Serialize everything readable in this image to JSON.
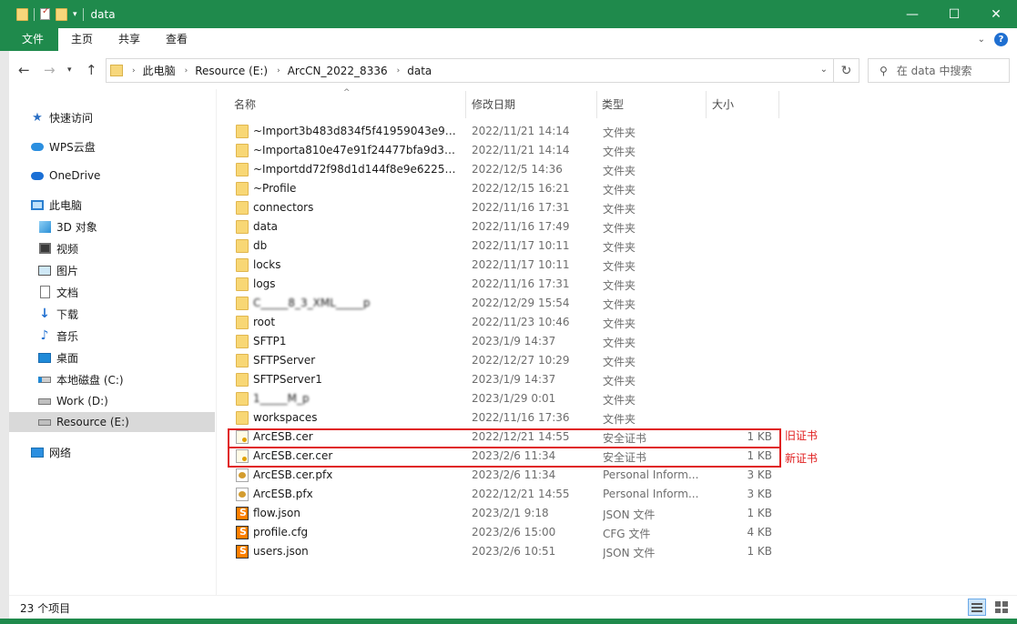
{
  "window": {
    "title": "data",
    "controls": [
      "—",
      "☐",
      "✕"
    ]
  },
  "ribbon": {
    "tabs": [
      "文件",
      "主页",
      "共享",
      "查看"
    ],
    "help": "?"
  },
  "address": {
    "crumbs": [
      "此电脑",
      "Resource (E:)",
      "ArcCN_2022_8336",
      "data"
    ],
    "search_placeholder": "在 data 中搜索"
  },
  "nav": {
    "items": [
      {
        "label": "快速访问",
        "icon": "star-icon"
      },
      {
        "label": "WPS云盘",
        "icon": "cloud-icon"
      },
      {
        "label": "OneDrive",
        "icon": "onedrive-icon"
      },
      {
        "label": "此电脑",
        "icon": "computer-icon"
      },
      {
        "label": "3D 对象",
        "icon": "3d-objects-icon"
      },
      {
        "label": "视频",
        "icon": "video-icon"
      },
      {
        "label": "图片",
        "icon": "pictures-icon"
      },
      {
        "label": "文档",
        "icon": "documents-icon"
      },
      {
        "label": "下载",
        "icon": "download-icon"
      },
      {
        "label": "音乐",
        "icon": "music-icon"
      },
      {
        "label": "桌面",
        "icon": "desktop-icon"
      },
      {
        "label": "本地磁盘 (C:)",
        "icon": "drive-c-icon"
      },
      {
        "label": "Work (D:)",
        "icon": "drive-icon"
      },
      {
        "label": "Resource (E:)",
        "icon": "drive-icon"
      },
      {
        "label": "网络",
        "icon": "network-icon"
      }
    ]
  },
  "columns": {
    "name": "名称",
    "date": "修改日期",
    "type": "类型",
    "size": "大小"
  },
  "files": [
    {
      "name": "~Import3b483d834f5f41959043e9c8...",
      "date": "2022/11/21 14:14",
      "type": "文件夹",
      "size": "",
      "icon": "folder-icon"
    },
    {
      "name": "~Importa810e47e91f24477bfa9d30b...",
      "date": "2022/11/21 14:14",
      "type": "文件夹",
      "size": "",
      "icon": "folder-icon"
    },
    {
      "name": "~Importdd72f98d1d144f8e9e622569...",
      "date": "2022/12/5 14:36",
      "type": "文件夹",
      "size": "",
      "icon": "folder-icon"
    },
    {
      "name": "~Profile",
      "date": "2022/12/15 16:21",
      "type": "文件夹",
      "size": "",
      "icon": "folder-icon"
    },
    {
      "name": "connectors",
      "date": "2022/11/16 17:31",
      "type": "文件夹",
      "size": "",
      "icon": "folder-icon"
    },
    {
      "name": "data",
      "date": "2022/11/16 17:49",
      "type": "文件夹",
      "size": "",
      "icon": "folder-icon"
    },
    {
      "name": "db",
      "date": "2022/11/17 10:11",
      "type": "文件夹",
      "size": "",
      "icon": "folder-icon"
    },
    {
      "name": "locks",
      "date": "2022/11/17 10:11",
      "type": "文件夹",
      "size": "",
      "icon": "folder-icon"
    },
    {
      "name": "logs",
      "date": "2022/11/16 17:31",
      "type": "文件夹",
      "size": "",
      "icon": "folder-icon"
    },
    {
      "name": "C_____8_3_XML_____p",
      "date": "2022/12/29 15:54",
      "type": "文件夹",
      "size": "",
      "icon": "folder-icon",
      "blurred": true
    },
    {
      "name": "root",
      "date": "2022/11/23 10:46",
      "type": "文件夹",
      "size": "",
      "icon": "folder-icon"
    },
    {
      "name": "SFTP1",
      "date": "2023/1/9 14:37",
      "type": "文件夹",
      "size": "",
      "icon": "folder-icon"
    },
    {
      "name": "SFTPServer",
      "date": "2022/12/27 10:29",
      "type": "文件夹",
      "size": "",
      "icon": "folder-icon"
    },
    {
      "name": "SFTPServer1",
      "date": "2023/1/9 14:37",
      "type": "文件夹",
      "size": "",
      "icon": "folder-icon"
    },
    {
      "name": "1_____M_p",
      "date": "2023/1/29 0:01",
      "type": "文件夹",
      "size": "",
      "icon": "folder-icon",
      "blurred": true
    },
    {
      "name": "workspaces",
      "date": "2022/11/16 17:36",
      "type": "文件夹",
      "size": "",
      "icon": "folder-icon"
    },
    {
      "name": "ArcESB.cer",
      "date": "2022/12/21 14:55",
      "type": "安全证书",
      "size": "1 KB",
      "icon": "certificate-icon"
    },
    {
      "name": "ArcESB.cer.cer",
      "date": "2023/2/6 11:34",
      "type": "安全证书",
      "size": "1 KB",
      "icon": "certificate-icon"
    },
    {
      "name": "ArcESB.cer.pfx",
      "date": "2023/2/6 11:34",
      "type": "Personal Inform...",
      "size": "3 KB",
      "icon": "pfx-icon"
    },
    {
      "name": "ArcESB.pfx",
      "date": "2022/12/21 14:55",
      "type": "Personal Inform...",
      "size": "3 KB",
      "icon": "pfx-icon"
    },
    {
      "name": "flow.json",
      "date": "2023/2/1 9:18",
      "type": "JSON 文件",
      "size": "1 KB",
      "icon": "sublime-file-icon"
    },
    {
      "name": "profile.cfg",
      "date": "2023/2/6 15:00",
      "type": "CFG 文件",
      "size": "4 KB",
      "icon": "sublime-file-icon"
    },
    {
      "name": "users.json",
      "date": "2023/2/6 10:51",
      "type": "JSON 文件",
      "size": "1 KB",
      "icon": "sublime-file-icon"
    }
  ],
  "annotations": {
    "old_cert": "旧证书",
    "new_cert": "新证书",
    "color": "#e01e1e"
  },
  "status": {
    "item_count": "23 个项目"
  },
  "colors": {
    "accent": "#1f8a4c",
    "selected": "#d9d9d9"
  }
}
